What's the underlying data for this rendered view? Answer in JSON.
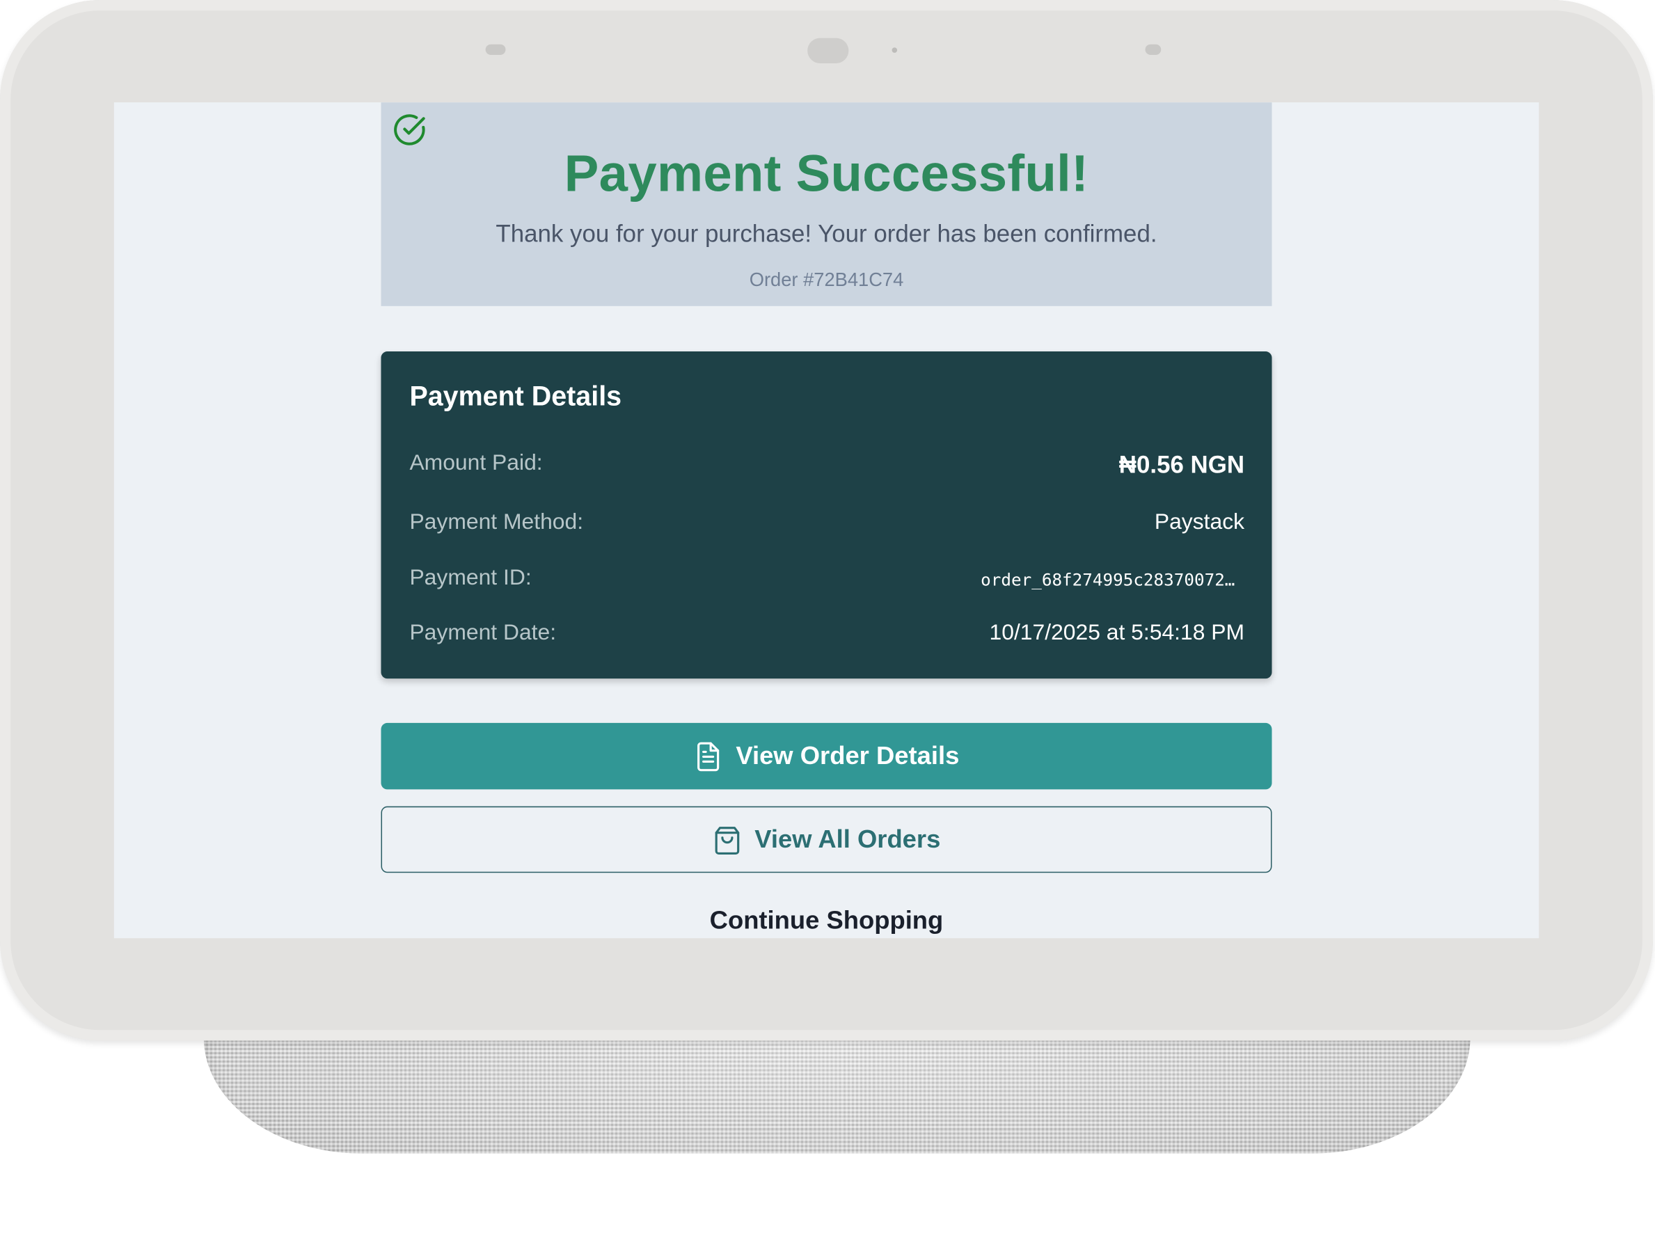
{
  "success": {
    "title": "Payment Successful!",
    "message": "Thank you for your purchase! Your order has been confirmed.",
    "order_number": "Order #72B41C74",
    "icon": "check-circle-icon"
  },
  "payment_details": {
    "heading": "Payment Details",
    "rows": [
      {
        "label": "Amount Paid:",
        "value": "₦0.56 NGN"
      },
      {
        "label": "Payment Method:",
        "value": "Paystack"
      },
      {
        "label": "Payment ID:",
        "value": "order_68f274995c28370072…"
      },
      {
        "label": "Payment Date:",
        "value": "10/17/2025 at 5:54:18 PM"
      }
    ]
  },
  "actions": {
    "view_order_details": {
      "label": "View Order Details",
      "icon": "document-icon"
    },
    "view_all_orders": {
      "label": "View All Orders",
      "icon": "shopping-bag-icon"
    },
    "continue_shopping": "Continue Shopping"
  },
  "colors": {
    "success_green": "#2e8a5c",
    "header_bg": "#cbd5e0",
    "details_bg": "#1e4147",
    "primary_teal": "#319795",
    "screen_bg": "#edf1f5"
  }
}
